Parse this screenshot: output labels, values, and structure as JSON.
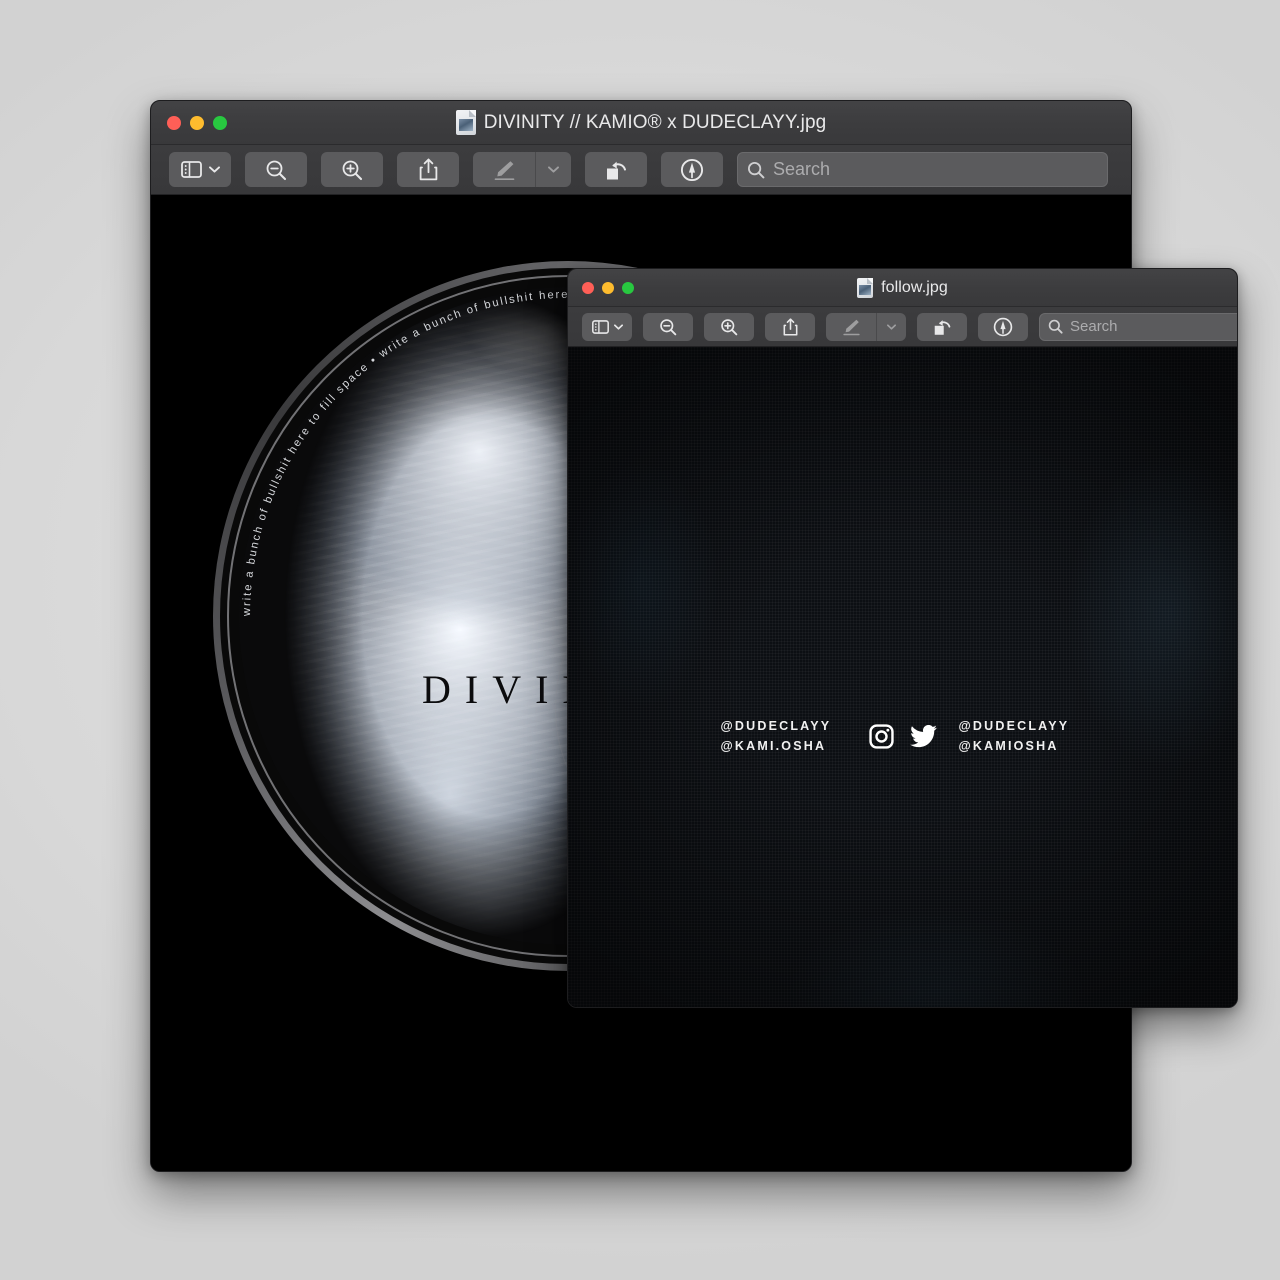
{
  "desktop": {
    "background_color": "#dcdcdc"
  },
  "windows": {
    "main": {
      "title": "DIVINITY // KAMIO® x DUDECLAYY.jpg",
      "doc_icon": "jpeg-document-icon",
      "traffic_lights": [
        {
          "name": "close-button",
          "color": "#ff5f57"
        },
        {
          "name": "minimize-button",
          "color": "#febc2e"
        },
        {
          "name": "zoom-button",
          "color": "#28c840"
        }
      ],
      "toolbar": {
        "sidebar_label": "sidebar-view",
        "zoom_out_label": "zoom-out",
        "zoom_in_label": "zoom-in",
        "share_label": "share",
        "markup_label": "markup",
        "markup_dropdown_label": "markup-options",
        "rotate_label": "rotate-left",
        "annotate_label": "annotate",
        "search_placeholder": "Search",
        "search_value": ""
      },
      "artwork": {
        "title_text": "DIVINITY",
        "circular_text": "write a bunch of bullshit here to fill space • write a bunch of bullshit here to fill space • write a bunch of bullshit here to fill space • ",
        "subject": "angel-wing-photograph",
        "background_color": "#000000"
      }
    },
    "follow": {
      "title": "follow.jpg",
      "doc_icon": "jpeg-document-icon",
      "traffic_lights": [
        {
          "name": "close-button",
          "color": "#ff5f57"
        },
        {
          "name": "minimize-button",
          "color": "#febc2e"
        },
        {
          "name": "zoom-button",
          "color": "#28c840"
        }
      ],
      "toolbar": {
        "sidebar_label": "sidebar-view",
        "zoom_out_label": "zoom-out",
        "zoom_in_label": "zoom-in",
        "share_label": "share",
        "markup_label": "markup",
        "markup_dropdown_label": "markup-options",
        "rotate_label": "rotate-left",
        "annotate_label": "annotate",
        "search_placeholder": "Search",
        "search_value": ""
      },
      "artwork": {
        "background_color": "#0c0f13",
        "left_handles": [
          "@DUDECLAYY",
          "@KAMI.OSHA"
        ],
        "right_handles": [
          "@DUDECLAYY",
          "@KAMIOSHA"
        ],
        "icons": [
          "instagram-icon",
          "twitter-icon"
        ]
      }
    }
  }
}
